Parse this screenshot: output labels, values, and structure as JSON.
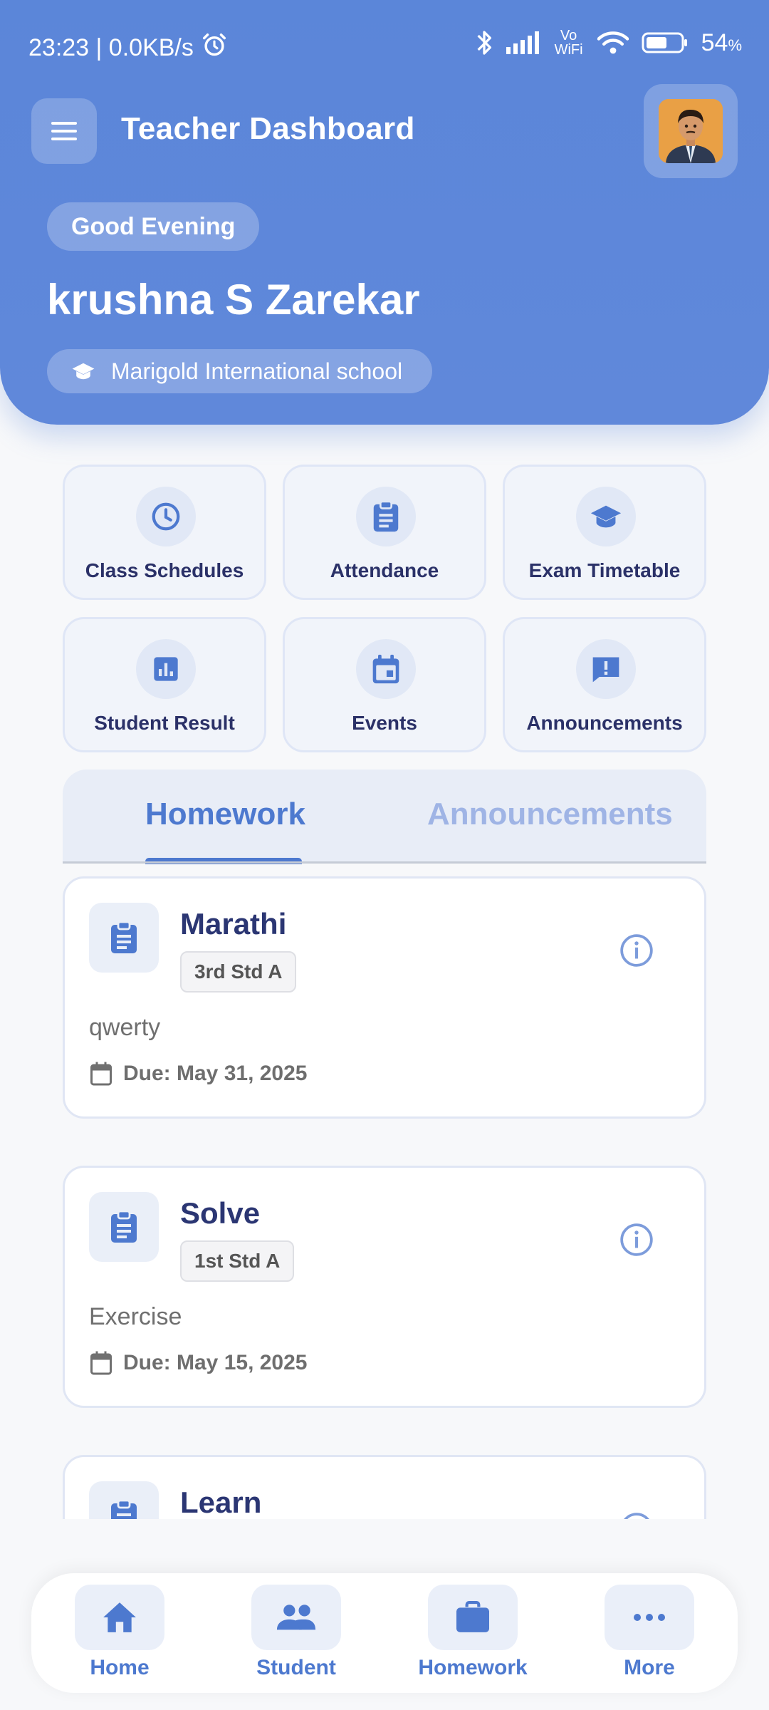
{
  "status_bar": {
    "time_speed": "23:23 | 0.0KB/s",
    "network_label": "Vo WiFi",
    "battery_percent": "54",
    "battery_unit": "%"
  },
  "header": {
    "title": "Teacher Dashboard",
    "greeting": "Good Evening",
    "user_name": "krushna S Zarekar",
    "school": "Marigold International school"
  },
  "quick_actions": [
    {
      "label": "Class Schedules",
      "icon": "clock-icon"
    },
    {
      "label": "Attendance",
      "icon": "clipboard-icon"
    },
    {
      "label": "Exam Timetable",
      "icon": "graduation-cap-icon"
    },
    {
      "label": "Student Result",
      "icon": "bar-chart-icon"
    },
    {
      "label": "Events",
      "icon": "calendar-icon"
    },
    {
      "label": "Announcements",
      "icon": "announcement-icon"
    }
  ],
  "tabs": {
    "active": "Homework",
    "items": [
      "Homework",
      "Announcements"
    ]
  },
  "homework": [
    {
      "subject": "Marathi",
      "class": "3rd Std A",
      "description": "qwerty",
      "due": "Due: May 31, 2025"
    },
    {
      "subject": "Solve",
      "class": "1st Std A",
      "description": "Exercise",
      "due": "Due: May 15, 2025"
    },
    {
      "subject": "Learn",
      "class": "",
      "description": "",
      "due": ""
    }
  ],
  "bottom_nav": [
    {
      "label": "Home",
      "icon": "home-icon"
    },
    {
      "label": "Student",
      "icon": "people-icon"
    },
    {
      "label": "Homework",
      "icon": "briefcase-icon"
    },
    {
      "label": "More",
      "icon": "more-icon"
    }
  ],
  "colors": {
    "header_blue": "#5b86d9",
    "accent": "#4d79cf",
    "inactive_tab": "#9fb4e5",
    "text_dark": "#2b3673"
  }
}
